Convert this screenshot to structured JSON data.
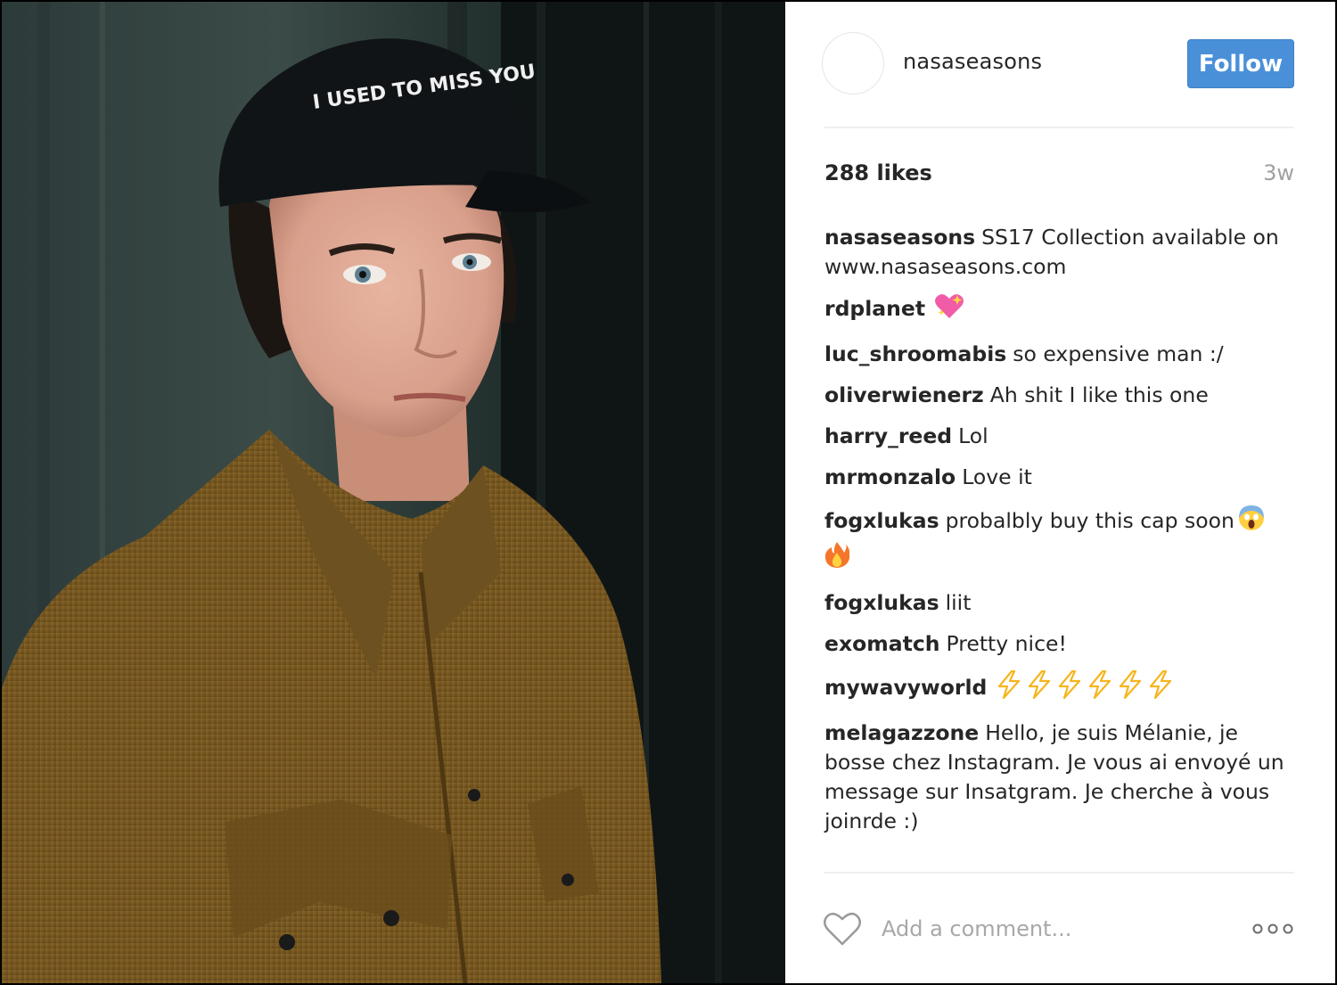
{
  "post": {
    "username": "nasaseasons",
    "follow_label": "Follow",
    "likes": "288 likes",
    "time": "3w",
    "add_comment_placeholder": "Add a comment...",
    "photo_cap_text": "I USED TO MISS YOU"
  },
  "comments": [
    {
      "user": "nasaseasons",
      "text": "SS17 Collection available on www.nasaseasons.com",
      "emoji": []
    },
    {
      "user": "rdplanet",
      "text": "",
      "emoji": [
        "sparkling-heart-icon"
      ]
    },
    {
      "user": "luc_shroomabis",
      "text": "so expensive man :/",
      "emoji": []
    },
    {
      "user": "oliverwienerz",
      "text": "Ah shit I like this one",
      "emoji": []
    },
    {
      "user": "harry_reed",
      "text": "Lol",
      "emoji": []
    },
    {
      "user": "mrmonzalo",
      "text": "Love it",
      "emoji": []
    },
    {
      "user": "fogxlukas",
      "text": "probalbly buy this cap soon",
      "emoji": [
        "screaming-face-icon",
        "fire-icon"
      ]
    },
    {
      "user": "fogxlukas",
      "text": "liit",
      "emoji": []
    },
    {
      "user": "exomatch",
      "text": "Pretty nice!",
      "emoji": []
    },
    {
      "user": "mywavyworld",
      "text": "",
      "emoji": [
        "lightning-icon",
        "lightning-icon",
        "lightning-icon",
        "lightning-icon",
        "lightning-icon",
        "lightning-icon"
      ]
    },
    {
      "user": "melagazzone",
      "text": "Hello, je suis Mélanie, je bosse chez Instagram. Je vous ai envoyé un message sur Insatgram. Je cherche à vous joinrde :)",
      "emoji": []
    }
  ],
  "colors": {
    "follow_button": "#4a90d9",
    "text": "#262626",
    "muted": "#a0a0a0",
    "divider": "#efefef"
  }
}
